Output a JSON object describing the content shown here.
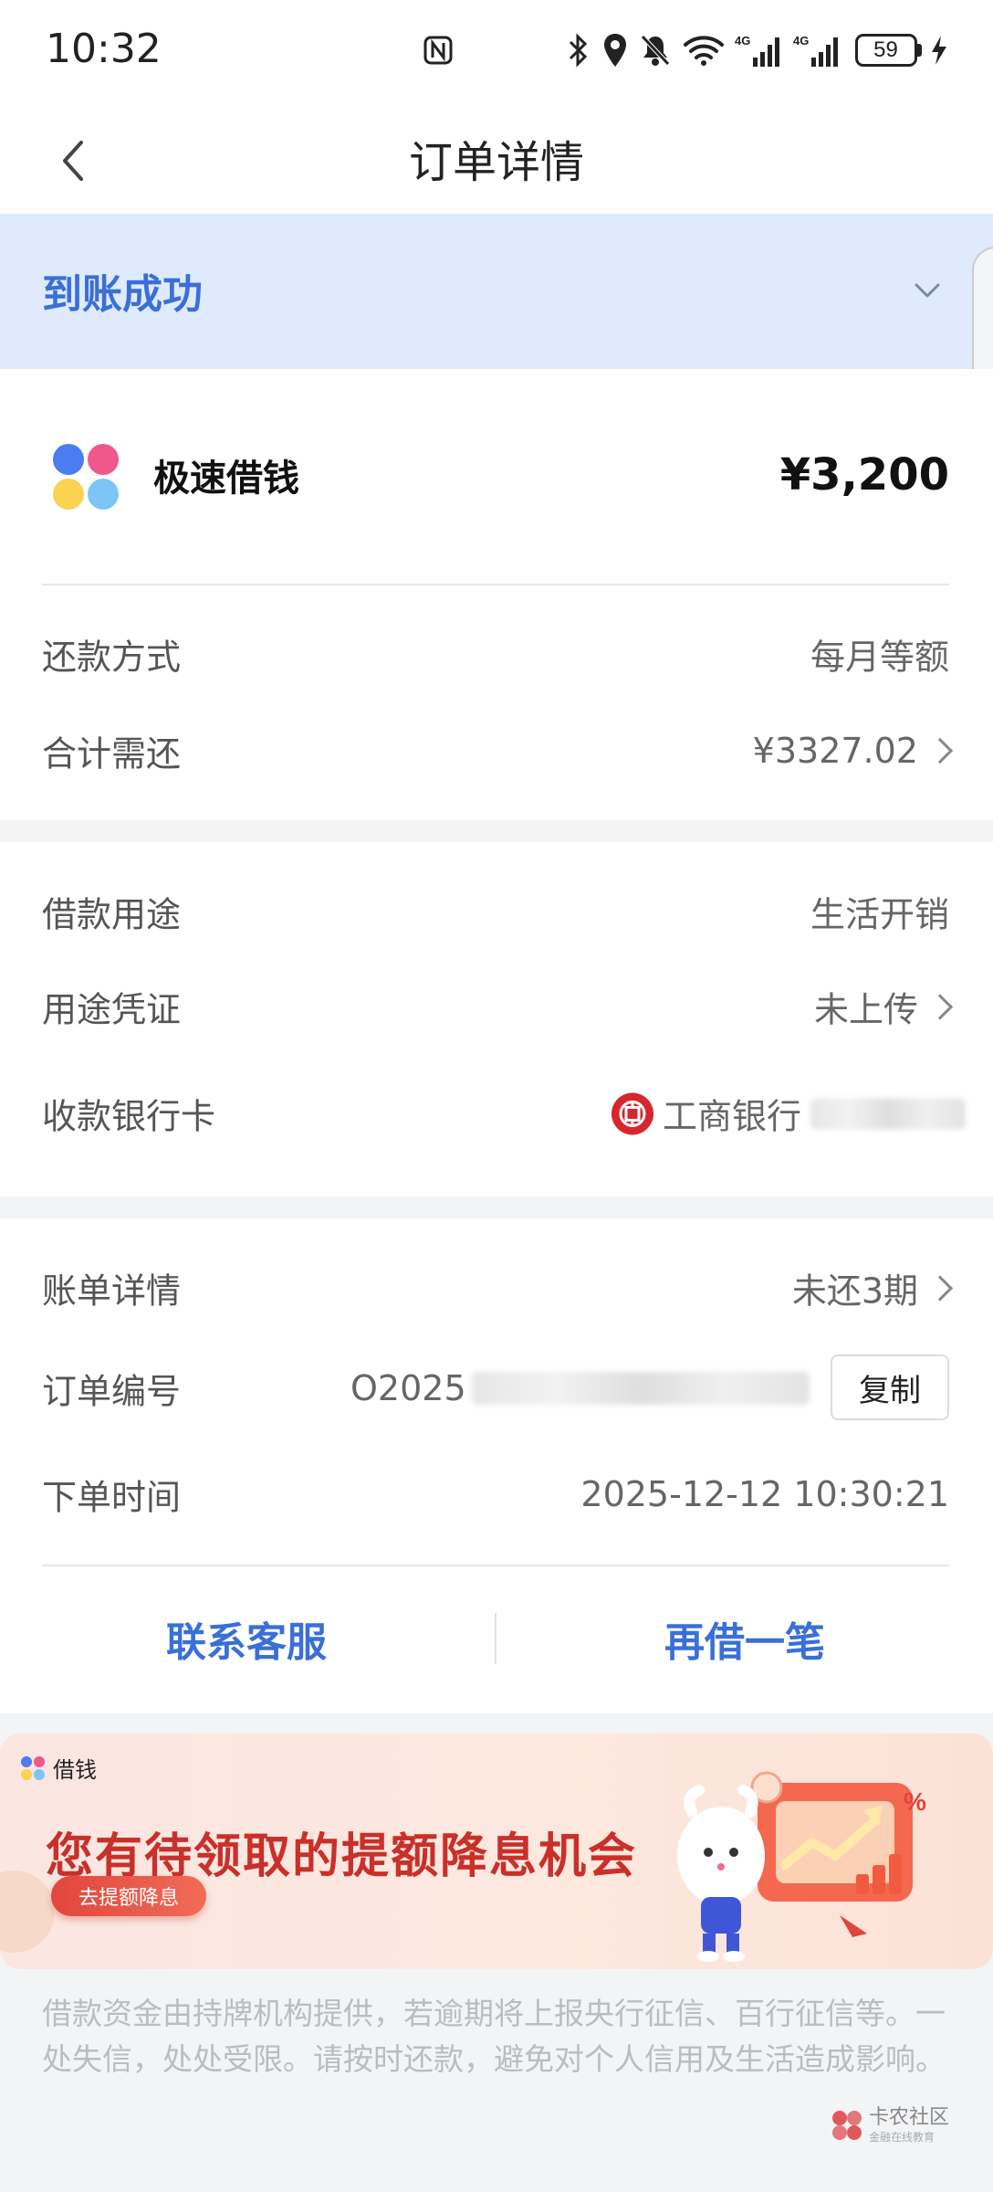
{
  "status_bar": {
    "time": "10:32",
    "battery": "59"
  },
  "nav": {
    "title": "订单详情"
  },
  "banner": {
    "status": "到账成功"
  },
  "product": {
    "name": "极速借钱",
    "amount": "¥3,200"
  },
  "rows": {
    "repay_method": {
      "label": "还款方式",
      "value": "每月等额"
    },
    "total_due": {
      "label": "合计需还",
      "value": "¥3327.02"
    },
    "purpose": {
      "label": "借款用途",
      "value": "生活开销"
    },
    "proof": {
      "label": "用途凭证",
      "value": "未上传"
    },
    "bank_card": {
      "label": "收款银行卡",
      "value": "工商银行"
    },
    "bill_detail": {
      "label": "账单详情",
      "value": "未还3期"
    },
    "order_no": {
      "label": "订单编号",
      "value": "O2025"
    },
    "order_time": {
      "label": "下单时间",
      "value": "2025-12-12 10:30:21"
    }
  },
  "buttons": {
    "copy": "复制",
    "contact": "联系客服",
    "borrow_again": "再借一笔"
  },
  "promo": {
    "tag": "借钱",
    "title": "您有待领取的提额降息机会",
    "cta": "去提额降息"
  },
  "disclaimer": "借款资金由持牌机构提供，若逾期将上报央行征信、百行征信等。一处失信，处处受限。请按时还款，避免对个人信用及生活造成影响。",
  "watermark": {
    "name": "卡农社区",
    "sub": "金融在线教育"
  },
  "colors": {
    "accent": "#3a6fd8",
    "banner_bg": "#dfeafc",
    "promo_red": "#c9302a",
    "icbc_red": "#d7262c"
  }
}
